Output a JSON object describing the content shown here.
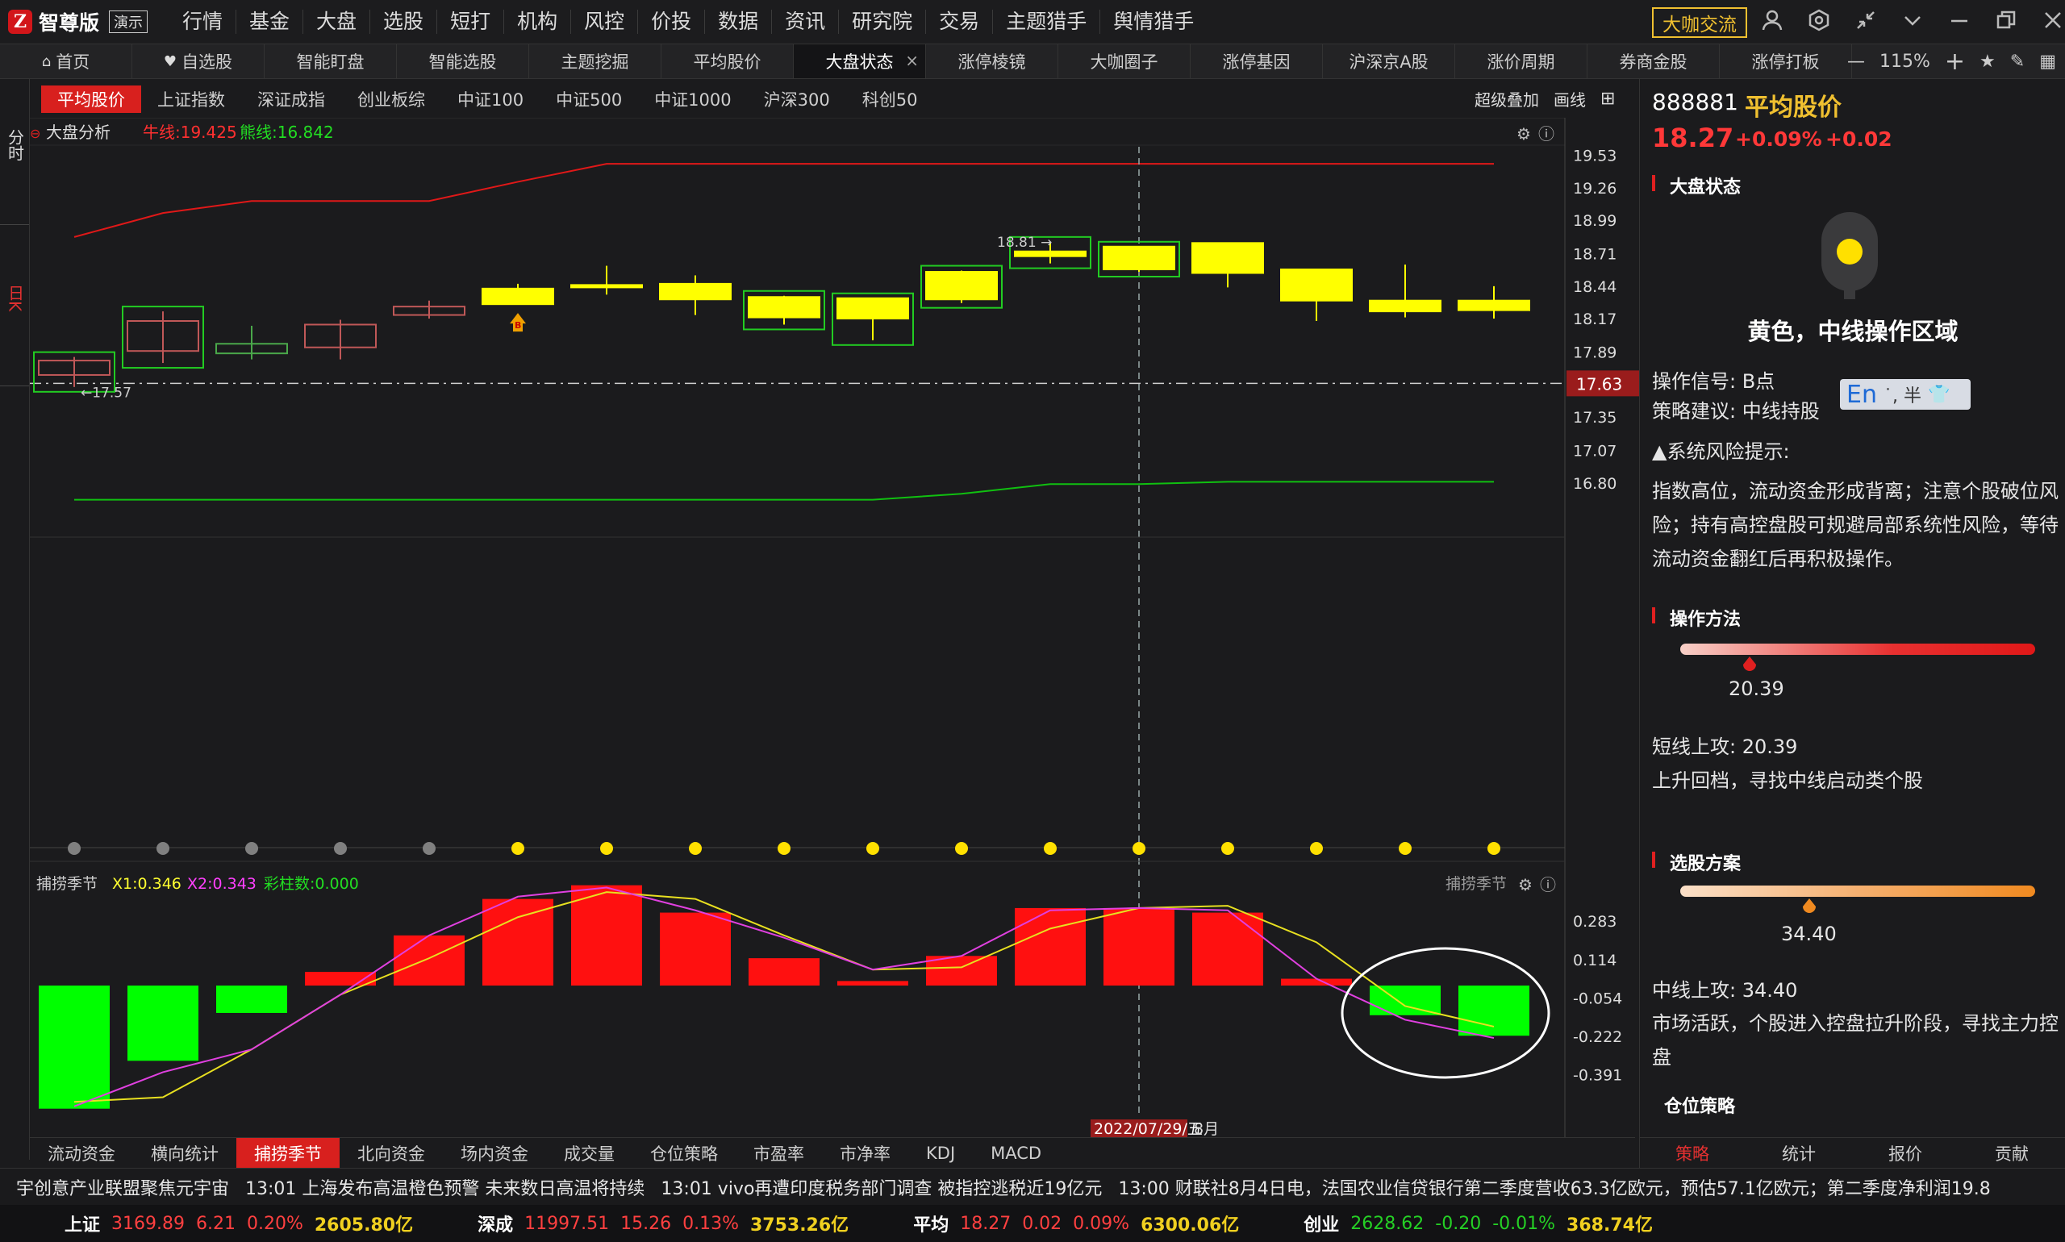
{
  "app": {
    "logo_char": "Z",
    "name": "智尊版",
    "badge": "演示",
    "menu": [
      "行情",
      "基金",
      "大盘",
      "选股",
      "短打",
      "机构",
      "风控",
      "价投",
      "数据",
      "资讯",
      "研究院",
      "交易",
      "主题猎手",
      "舆情猎手"
    ],
    "daka_button": "大咖交流"
  },
  "tabs": [
    {
      "label": "首页",
      "icon": "home-icon"
    },
    {
      "label": "自选股",
      "icon": "heart-icon"
    },
    {
      "label": "智能盯盘"
    },
    {
      "label": "智能选股"
    },
    {
      "label": "主题挖掘"
    },
    {
      "label": "平均股价"
    },
    {
      "label": "大盘状态",
      "active": true
    },
    {
      "label": "涨停棱镜"
    },
    {
      "label": "大咖圈子"
    },
    {
      "label": "涨停基因"
    },
    {
      "label": "沪深京A股"
    },
    {
      "label": "涨价周期"
    },
    {
      "label": "券商金股"
    },
    {
      "label": "涨停打板"
    }
  ],
  "zoom": "115%",
  "left_tabs": {
    "intraday": "分时",
    "daily": "日K"
  },
  "index_tabs": [
    "平均股价",
    "上证指数",
    "深证成指",
    "创业板综",
    "中证100",
    "中证500",
    "中证1000",
    "沪深300",
    "科创50"
  ],
  "chart_tools": {
    "overlay": "超级叠加",
    "draw": "画线"
  },
  "main_chart_header": {
    "name": "大盘分析",
    "bull_label": "牛线:19.425",
    "bear_label": "熊线:16.842"
  },
  "sub_chart_header": {
    "name": "捕捞季节",
    "x1": "X1:0.346",
    "x2": "X2:0.343",
    "bars": "彩柱数:0.000",
    "right_name": "捕捞季节"
  },
  "chart_data": [
    {
      "type": "candlestick",
      "name": "大盘分析",
      "ylim": [
        16.55,
        19.75
      ],
      "y_ticks": [
        "19.53",
        "19.26",
        "18.99",
        "18.71",
        "18.44",
        "18.17",
        "17.89",
        "17.63",
        "17.35",
        "17.07",
        "16.80"
      ],
      "current_price_label": "17.63",
      "annotations": {
        "high": "18.81",
        "low": "17.57"
      },
      "candles": [
        {
          "o": 17.7,
          "c": 17.82,
          "h": 17.85,
          "l": 17.6,
          "up": true,
          "box": true
        },
        {
          "o": 17.9,
          "c": 18.15,
          "h": 18.23,
          "l": 17.8,
          "up": true,
          "box": true
        },
        {
          "o": 17.96,
          "c": 17.88,
          "h": 18.11,
          "l": 17.83,
          "up": false
        },
        {
          "o": 17.93,
          "c": 18.12,
          "h": 18.16,
          "l": 17.83,
          "up": true
        },
        {
          "o": 18.2,
          "c": 18.27,
          "h": 18.32,
          "l": 18.17,
          "up": true
        },
        {
          "o": 18.42,
          "c": 18.29,
          "h": 18.46,
          "l": 18.29,
          "up": false,
          "yellow": true,
          "b_signal": true
        },
        {
          "o": 18.45,
          "c": 18.44,
          "h": 18.61,
          "l": 18.37,
          "yellow": true
        },
        {
          "o": 18.46,
          "c": 18.33,
          "h": 18.53,
          "l": 18.2,
          "yellow": true
        },
        {
          "o": 18.35,
          "c": 18.18,
          "h": 18.36,
          "l": 18.12,
          "yellow": true,
          "box": true
        },
        {
          "o": 18.34,
          "c": 18.17,
          "h": 18.34,
          "l": 17.99,
          "yellow": true,
          "box": true
        },
        {
          "o": 18.56,
          "c": 18.33,
          "h": 18.57,
          "l": 18.3,
          "yellow": true,
          "box": true
        },
        {
          "o": 18.73,
          "c": 18.69,
          "h": 18.81,
          "l": 18.63,
          "yellow": true,
          "box": true
        },
        {
          "o": 18.77,
          "c": 18.58,
          "h": 18.77,
          "l": 18.56,
          "yellow": true,
          "box": true
        },
        {
          "o": 18.8,
          "c": 18.55,
          "h": 18.8,
          "l": 18.43,
          "yellow": true
        },
        {
          "o": 18.58,
          "c": 18.32,
          "h": 18.58,
          "l": 18.15,
          "yellow": true
        },
        {
          "o": 18.32,
          "c": 18.23,
          "h": 18.62,
          "l": 18.18,
          "yellow": true
        },
        {
          "o": 18.32,
          "c": 18.24,
          "h": 18.44,
          "l": 18.17,
          "yellow": true
        }
      ],
      "bull_line": [
        18.85,
        19.05,
        19.15,
        19.15,
        19.15,
        19.31,
        19.46,
        19.46,
        19.46,
        19.46,
        19.46,
        19.46,
        19.46,
        19.46,
        19.46,
        19.46,
        19.46
      ],
      "bear_line": [
        16.66,
        16.66,
        16.66,
        16.66,
        16.66,
        16.66,
        16.66,
        16.66,
        16.66,
        16.66,
        16.71,
        16.79,
        16.79,
        16.81,
        16.81,
        16.81,
        16.81
      ],
      "signal_dots": [
        "gray",
        "gray",
        "gray",
        "gray",
        "gray",
        "yellow",
        "yellow",
        "yellow",
        "yellow",
        "yellow",
        "yellow",
        "yellow",
        "yellow",
        "yellow",
        "yellow",
        "yellow",
        "yellow"
      ]
    },
    {
      "type": "bar",
      "name": "捕捞季节",
      "ylim": [
        -0.58,
        0.46
      ],
      "y_ticks": [
        "0.283",
        "0.114",
        "-0.054",
        "-0.222",
        "-0.391"
      ],
      "bars": [
        -0.54,
        -0.33,
        -0.12,
        0.06,
        0.22,
        0.38,
        0.44,
        0.32,
        0.12,
        0.02,
        0.13,
        0.34,
        0.34,
        0.32,
        0.03,
        -0.13,
        -0.22
      ],
      "series": [
        {
          "name": "X1",
          "color": "#e8e020",
          "values": [
            -0.51,
            -0.49,
            -0.28,
            -0.04,
            0.12,
            0.3,
            0.41,
            0.38,
            0.22,
            0.07,
            0.08,
            0.25,
            0.34,
            0.35,
            0.19,
            -0.09,
            -0.18
          ]
        },
        {
          "name": "X2",
          "color": "#e040e0",
          "values": [
            -0.53,
            -0.38,
            -0.28,
            -0.04,
            0.22,
            0.39,
            0.43,
            0.33,
            0.21,
            0.07,
            0.13,
            0.33,
            0.34,
            0.33,
            0.03,
            -0.15,
            -0.23
          ]
        }
      ],
      "date_label": "2022/07/29/五",
      "month_label": "8月"
    }
  ],
  "bottom_tabs": [
    "流动资金",
    "横向统计",
    "捕捞季节",
    "北向资金",
    "场内资金",
    "成交量",
    "仓位策略",
    "市盈率",
    "市净率",
    "KDJ",
    "MACD"
  ],
  "bottom_active": "捕捞季节",
  "panel": {
    "code": "888881",
    "name": "平均股价",
    "price": "18.27",
    "pct": "+0.09%",
    "change": "+0.02",
    "status_title": "大盘状态",
    "status_text": "黄色，中线操作区域",
    "signal": "操作信号: B点",
    "advice": "策略建议: 中线持股",
    "ime": "En",
    "ime_extra": "˙, 半",
    "risk_title": "▲系统风险提示:",
    "risk_text": "指数高位，流动资金形成背离；注意个股破位风险；持有高控盘股可规避局部系统性风险，等待流动资金翻红后再积极操作。",
    "method_title": "操作方法",
    "method_value": "20.39",
    "short_up": "短线上攻: 20.39",
    "short_desc": "上升回档，寻找中线启动类个股",
    "plan_title": "选股方案",
    "plan_value": "34.40",
    "mid_up": "中线上攻: 34.40",
    "mid_desc": "市场活跃，个股进入控盘拉升阶段，寻找主力控盘",
    "position_title": "仓位策略",
    "tabs": [
      "策略",
      "统计",
      "报价",
      "贡献"
    ]
  },
  "ticker": [
    "宇创意产业联盟聚焦元宇宙",
    "13:01 上海发布高温橙色预警 未来数日高温将持续",
    "13:01 vivo再遭印度税务部门调查 被指控逃税近19亿元",
    "13:00 财联社8月4日电，法国农业信贷银行第二季度营收63.3亿欧元，预估57.1亿欧元；第二季度净利润19.8"
  ],
  "status": [
    {
      "name": "上证",
      "price": "3169.89",
      "chg": "6.21",
      "pct": "0.20%",
      "vol": "2605.80亿",
      "dir": "up"
    },
    {
      "name": "深成",
      "price": "11997.51",
      "chg": "15.26",
      "pct": "0.13%",
      "vol": "3753.26亿",
      "dir": "up"
    },
    {
      "name": "平均",
      "price": "18.27",
      "chg": "0.02",
      "pct": "0.09%",
      "vol": "6300.06亿",
      "dir": "up"
    },
    {
      "name": "创业",
      "price": "2628.62",
      "chg": "-0.20",
      "pct": "-0.01%",
      "vol": "368.74亿",
      "dir": "down"
    }
  ],
  "colors": {
    "up": "#ff3030",
    "down": "#10e010",
    "yellow_candle": "#ffff00",
    "bull_line": "#e01818",
    "bear_line": "#10c010",
    "accent": "#d8201e"
  }
}
